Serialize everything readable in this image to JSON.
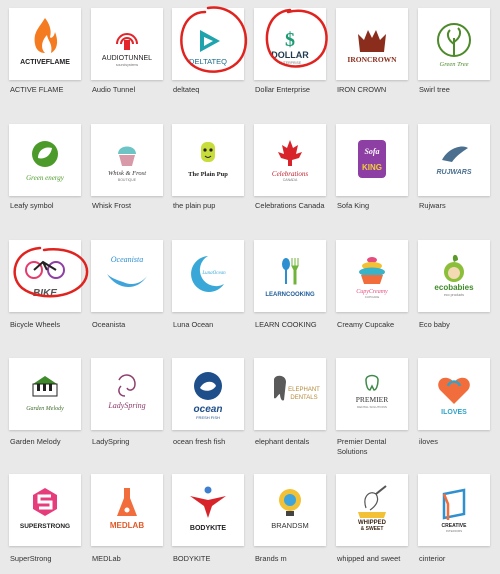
{
  "logos": [
    {
      "caption": "ACTIVE FLAME",
      "icon": "flame-icon",
      "wordmark": "ACTIVEFLAME"
    },
    {
      "caption": "Audio Tunnel",
      "icon": "audio-signal-icon",
      "wordmark": "AUDIOTUNNEL",
      "tagline": "soundsystems"
    },
    {
      "caption": "deltateq",
      "icon": "play-triangle-icon",
      "wordmark": "DELTATEQ"
    },
    {
      "caption": "Dollar Enterprise",
      "icon": "dollar-sign-icon",
      "wordmark": "DOLLAR",
      "tagline": "ENTERPRISE"
    },
    {
      "caption": "IRON CROWN",
      "icon": "crown-icon",
      "wordmark": "IRONCROWN"
    },
    {
      "caption": "Swirl tree",
      "icon": "swirl-tree-icon",
      "wordmark": "Green Tree"
    },
    {
      "caption": "Leafy symbol",
      "icon": "leaf-circle-icon",
      "wordmark": "Green energy"
    },
    {
      "caption": "Whisk Frost",
      "icon": "cupcake-icon",
      "wordmark": "Whisk & Frost",
      "tagline": "BOUTIQUE"
    },
    {
      "caption": "the plain pup",
      "icon": "dog-icon",
      "wordmark": "The Plain Pup"
    },
    {
      "caption": "Celebrations Canada",
      "icon": "maple-leaf-icon",
      "wordmark": "Celebrations",
      "tagline": "CANADA"
    },
    {
      "caption": "Sofa King",
      "icon": "sofa-icon",
      "wordmark_top": "Sofa",
      "wordmark": "KING"
    },
    {
      "caption": "Rujwars",
      "icon": "wing-icon",
      "wordmark": "RUJWARS"
    },
    {
      "caption": "Bicycle Wheels",
      "icon": "bicycle-icon",
      "wordmark": "BIKE"
    },
    {
      "caption": "Oceanista",
      "icon": "wave-icon",
      "wordmark": "Oceanista"
    },
    {
      "caption": "Luna Ocean",
      "icon": "crescent-moon-icon",
      "wordmark": "LunaOcean"
    },
    {
      "caption": "LEARN COOKING",
      "icon": "spoon-fork-icon",
      "wordmark": "LEARNCOOKING"
    },
    {
      "caption": "Creamy Cupcake",
      "icon": "layered-cupcake-icon",
      "wordmark": "CupyCreamy",
      "tagline": "CUPCAKE"
    },
    {
      "caption": "Eco baby",
      "icon": "baby-leaf-icon",
      "wordmark": "ecobabies",
      "tagline": "eco products"
    },
    {
      "caption": "Garden Melody",
      "icon": "piano-garden-icon",
      "wordmark": "Garden Melody"
    },
    {
      "caption": "LadySpring",
      "icon": "lady-icon",
      "wordmark": "LadySpring"
    },
    {
      "caption": "ocean fresh fish",
      "icon": "fish-icon",
      "wordmark": "ocean",
      "tagline": "FRESH FISH"
    },
    {
      "caption": "elephant dentals",
      "icon": "elephant-tooth-icon",
      "wordmark": "ELEPHANT",
      "tagline": "DENTALS"
    },
    {
      "caption": "Premier Dental Solutions",
      "icon": "tooth-icon",
      "wordmark": "PREMIER",
      "tagline": "DENTAL SOLUTIONS"
    },
    {
      "caption": "iloves",
      "icon": "heart-swirl-icon",
      "wordmark": "ILOVES"
    },
    {
      "caption": "SuperStrong",
      "icon": "s-hexagon-icon",
      "wordmark": "SUPERSTRONG"
    },
    {
      "caption": "MEDLab",
      "icon": "flask-icon",
      "wordmark": "MEDLAB"
    },
    {
      "caption": "BODYKITE",
      "icon": "kite-person-icon",
      "wordmark": "BODYKITE"
    },
    {
      "caption": "Brands m",
      "icon": "lightbulb-icon",
      "wordmark": "BRANDSM"
    },
    {
      "caption": "whipped and sweet",
      "icon": "whisk-icon",
      "wordmark": "WHIPPED",
      "tagline": "& SWEET"
    },
    {
      "caption": "cinterior",
      "icon": "interior-frame-icon",
      "wordmark": "CREATIVE",
      "tagline": "INTERIORS"
    }
  ],
  "annotation_color": "#e0231f"
}
